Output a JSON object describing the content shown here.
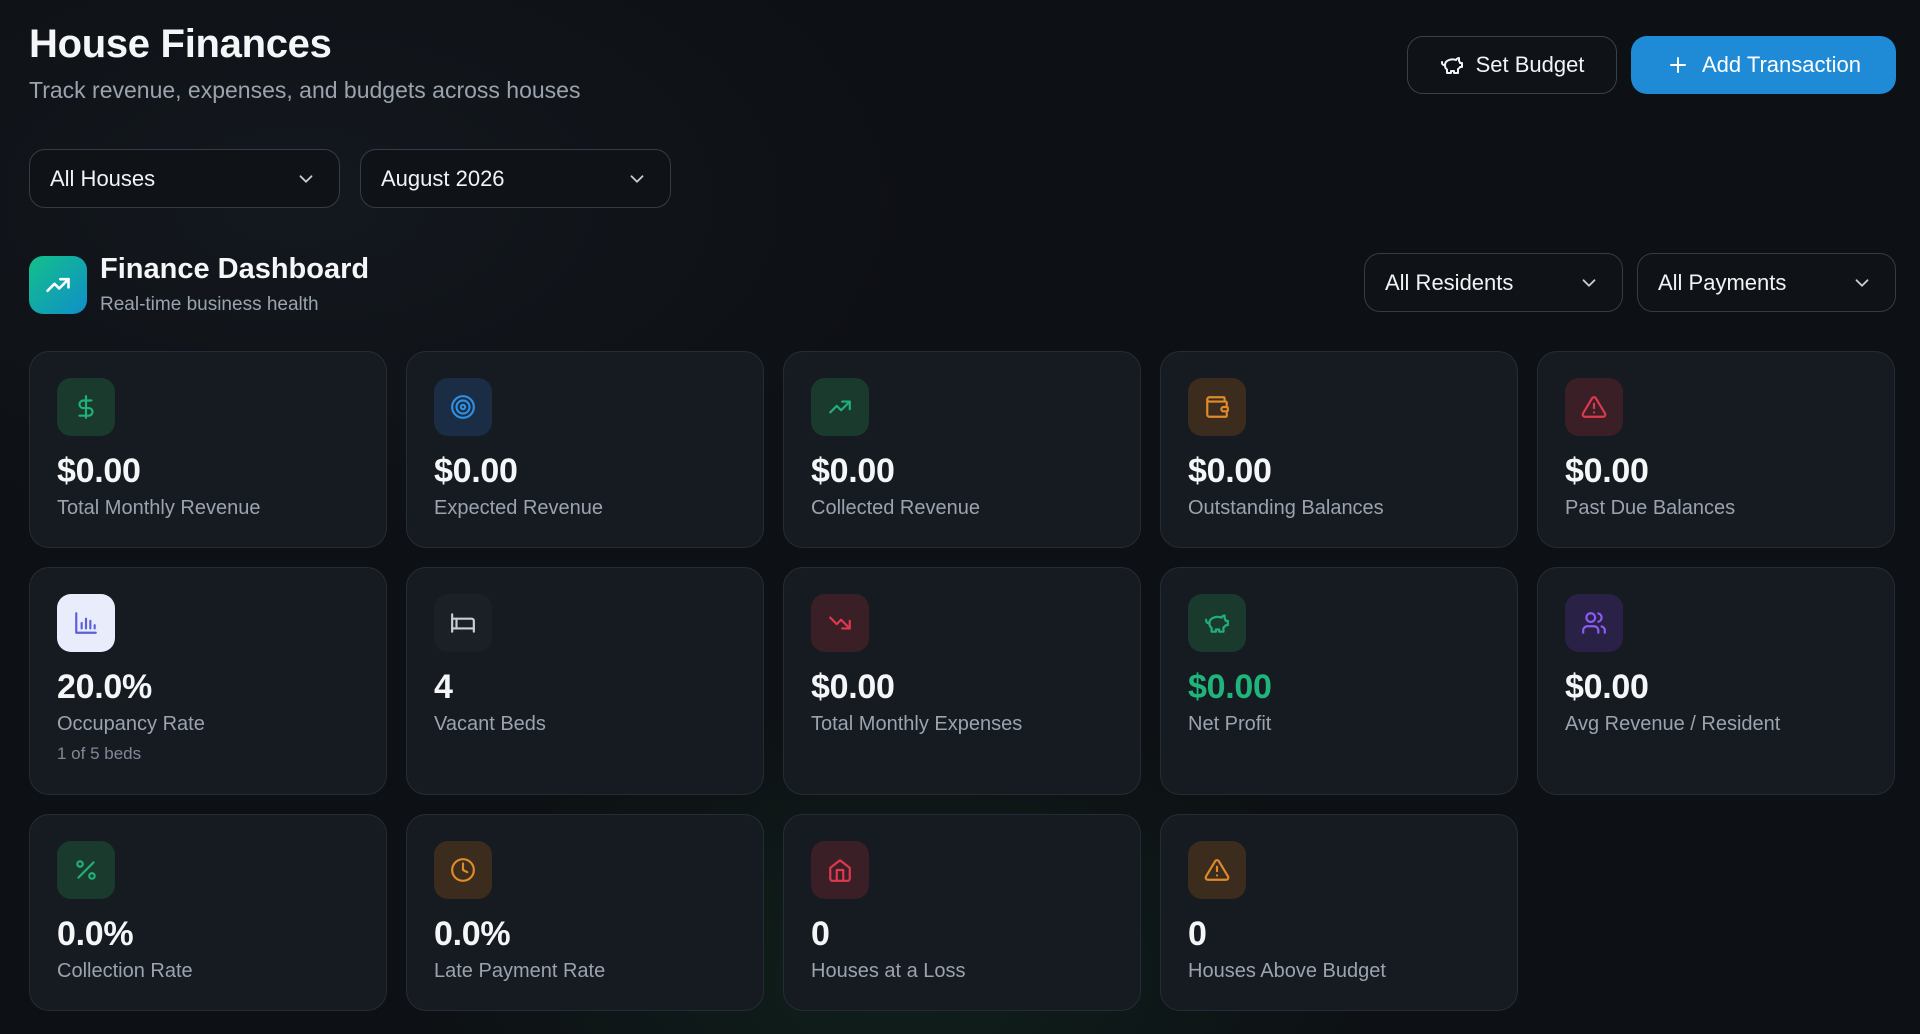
{
  "header": {
    "title": "House Finances",
    "subtitle": "Track revenue, expenses, and budgets across houses",
    "set_budget_label": "Set Budget",
    "add_transaction_label": "Add Transaction"
  },
  "filters": {
    "house": "All Houses",
    "month": "August 2026"
  },
  "dashboard": {
    "title": "Finance Dashboard",
    "subtitle": "Real-time business health",
    "residents_filter": "All Residents",
    "payments_filter": "All Payments"
  },
  "cards": [
    {
      "value": "$0.00",
      "label": "Total Monthly Revenue",
      "icon": "dollar-icon"
    },
    {
      "value": "$0.00",
      "label": "Expected Revenue",
      "icon": "target-icon"
    },
    {
      "value": "$0.00",
      "label": "Collected Revenue",
      "icon": "trending-up-icon"
    },
    {
      "value": "$0.00",
      "label": "Outstanding Balances",
      "icon": "wallet-icon"
    },
    {
      "value": "$0.00",
      "label": "Past Due Balances",
      "icon": "alert-triangle-icon"
    },
    {
      "value": "20.0%",
      "label": "Occupancy Rate",
      "sublabel": "1 of 5 beds",
      "icon": "bar-chart-icon"
    },
    {
      "value": "4",
      "label": "Vacant Beds",
      "icon": "bed-icon"
    },
    {
      "value": "$0.00",
      "label": "Total Monthly Expenses",
      "icon": "trending-down-icon"
    },
    {
      "value": "$0.00",
      "label": "Net Profit",
      "icon": "piggy-bank-icon"
    },
    {
      "value": "$0.00",
      "label": "Avg Revenue / Resident",
      "icon": "users-icon"
    },
    {
      "value": "0.0%",
      "label": "Collection Rate",
      "icon": "percent-icon"
    },
    {
      "value": "0.0%",
      "label": "Late Payment Rate",
      "icon": "clock-icon"
    },
    {
      "value": "0",
      "label": "Houses at a Loss",
      "icon": "house-icon"
    },
    {
      "value": "0",
      "label": "Houses Above Budget",
      "icon": "warning-icon"
    }
  ],
  "colors": {
    "primary_button": "#1f8ad6",
    "net_profit_value": "#1fb57a"
  }
}
